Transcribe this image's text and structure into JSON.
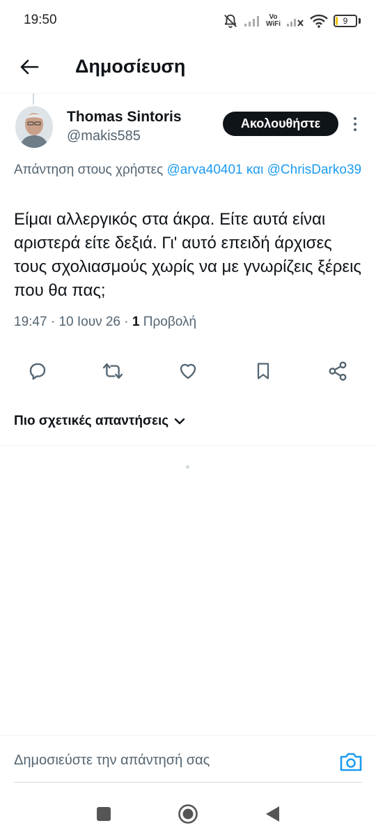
{
  "status_bar": {
    "time": "19:50",
    "vowifi_top": "Vo",
    "vowifi_bottom": "WiFi",
    "battery_level": "9",
    "battery_fraction": 0.09
  },
  "header": {
    "title": "Δημοσίευση"
  },
  "post": {
    "author_name": "Thomas Sintoris",
    "author_handle": "@makis585",
    "follow_label": "Ακολουθήστε",
    "reply_prefix": "Απάντηση στους χρήστες",
    "reply_mention_1": "@arva40401",
    "reply_joiner": "και",
    "reply_mention_2": "@ChrisDarko39",
    "text": "Είμαι αλλεργικός στα άκρα. Είτε αυτά είναι αριστερά είτε δεξιά. Γι' αυτό επειδή άρχισες τους σχολιασμούς χωρίς να με γνωρίζεις ξέρεις που θα πας;",
    "time": "19:47",
    "date": "10 Ιουν 26",
    "views_count": "1",
    "views_label": "Προβολή"
  },
  "replies": {
    "sort_label": "Πιο σχετικές απαντήσεις"
  },
  "composer": {
    "placeholder": "Δημοσιεύστε την απάντησή σας"
  },
  "colors": {
    "accent": "#1d9bf0",
    "text_primary": "#0f1419",
    "text_secondary": "#536471",
    "battery": "#f2c200"
  },
  "icons": {
    "back": "arrow-left-icon",
    "more": "more-vertical-icon",
    "reply": "reply-icon",
    "repost": "repost-icon",
    "like": "heart-icon",
    "bookmark": "bookmark-icon",
    "share": "share-icon",
    "sort": "chevron-down-icon",
    "camera": "camera-icon"
  }
}
